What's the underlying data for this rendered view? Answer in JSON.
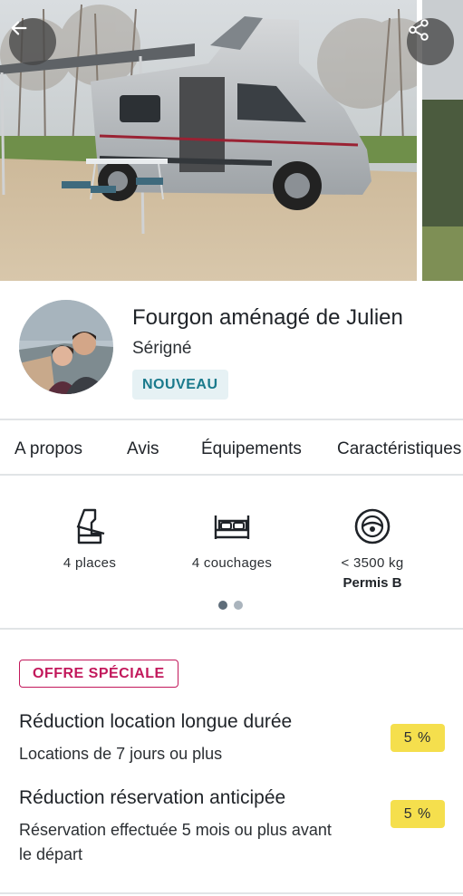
{
  "hero": {
    "back_icon": "arrow-left-icon",
    "share_icon": "share-icon"
  },
  "host": {
    "title": "Fourgon aménagé de Julien",
    "location": "Sérigné",
    "badge": "NOUVEAU"
  },
  "tabs": [
    {
      "label": "A propos",
      "active": true
    },
    {
      "label": "Avis",
      "active": false
    },
    {
      "label": "Équipements",
      "active": false
    },
    {
      "label": "Caractéristiques",
      "active": false
    }
  ],
  "features": [
    {
      "icon": "seat-icon",
      "label": "4 places",
      "sub": ""
    },
    {
      "icon": "bed-icon",
      "label": "4 couchages",
      "sub": ""
    },
    {
      "icon": "steering-wheel-icon",
      "label": "< 3500 kg",
      "sub": "Permis B"
    }
  ],
  "carousel": {
    "pages": 2,
    "current": 1
  },
  "offer": {
    "tag": "OFFRE SPÉCIALE",
    "discounts": [
      {
        "title": "Réduction location longue durée",
        "description": "Locations de 7 jours ou plus",
        "value": "5 %"
      },
      {
        "title": "Réduction réservation anticipée",
        "description": "Réservation effectuée 5 mois ou plus avant le départ",
        "value": "5 %"
      }
    ]
  },
  "colors": {
    "accent": "#c2185b",
    "badge_bg": "#e6f1f4",
    "badge_text": "#1a7a8c",
    "discount_bg": "#f5df4d"
  }
}
